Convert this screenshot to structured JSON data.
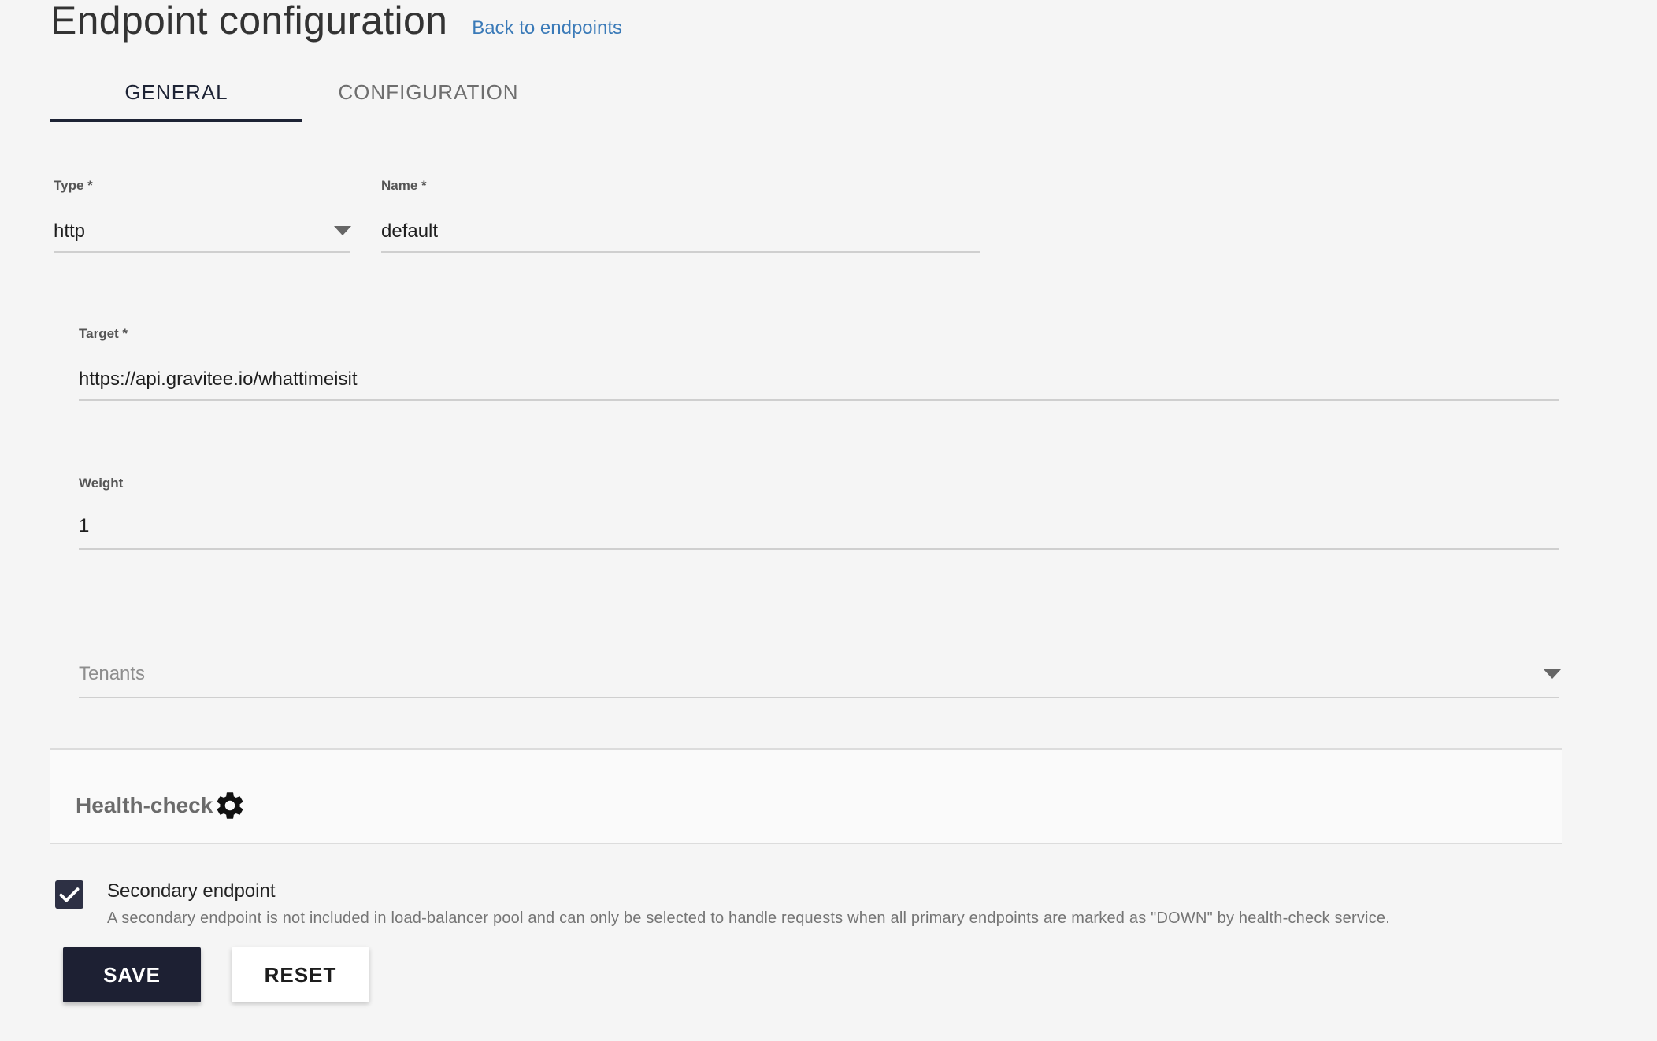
{
  "header": {
    "title": "Endpoint configuration",
    "back_link": "Back to endpoints"
  },
  "tabs": [
    {
      "label": "GENERAL",
      "active": true
    },
    {
      "label": "CONFIGURATION",
      "active": false
    }
  ],
  "form": {
    "type": {
      "label": "Type *",
      "value": "http"
    },
    "name": {
      "label": "Name *",
      "value": "default"
    },
    "target": {
      "label": "Target *",
      "value": "https://api.gravitee.io/whattimeisit"
    },
    "weight": {
      "label": "Weight",
      "value": "1"
    },
    "tenants": {
      "placeholder": "Tenants"
    }
  },
  "health_check": {
    "title": "Health-check",
    "icon": "gear-icon"
  },
  "secondary": {
    "checked": true,
    "label": "Secondary endpoint",
    "help": "A secondary endpoint is not included in load-balancer pool and can only be selected to handle requests when all primary endpoints are marked as \"DOWN\" by health-check service."
  },
  "buttons": {
    "save": "SAVE",
    "reset": "RESET"
  },
  "colors": {
    "primary": "#1d2033",
    "link": "#3a7ab8",
    "background": "#f5f5f5"
  }
}
